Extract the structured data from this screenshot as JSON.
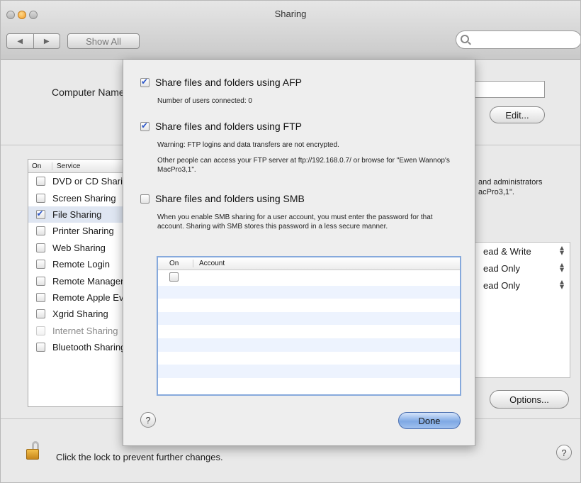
{
  "window": {
    "title": "Sharing"
  },
  "toolbar": {
    "show_all_label": "Show All",
    "back_glyph": "◀",
    "forward_glyph": "▶",
    "search_placeholder": ""
  },
  "computer_name": {
    "label": "Computer Name:",
    "value": "",
    "edit_label": "Edit..."
  },
  "services": {
    "header_on": "On",
    "header_service": "Service",
    "items": [
      {
        "label": "DVD or CD Sharing",
        "on": false,
        "selected": false
      },
      {
        "label": "Screen Sharing",
        "on": false,
        "selected": false
      },
      {
        "label": "File Sharing",
        "on": true,
        "selected": true
      },
      {
        "label": "Printer Sharing",
        "on": false,
        "selected": false
      },
      {
        "label": "Web Sharing",
        "on": false,
        "selected": false
      },
      {
        "label": "Remote Login",
        "on": false,
        "selected": false
      },
      {
        "label": "Remote Management",
        "on": false,
        "selected": false
      },
      {
        "label": "Remote Apple Events",
        "on": false,
        "selected": false
      },
      {
        "label": "Xgrid Sharing",
        "on": false,
        "selected": false
      },
      {
        "label": "Internet Sharing",
        "on": false,
        "selected": false,
        "dimmed": true
      },
      {
        "label": "Bluetooth Sharing",
        "on": false,
        "selected": false
      }
    ]
  },
  "file_sharing": {
    "description_tail": "and administrators",
    "description_tail2": "acPro3,1\".",
    "permissions": [
      "ead & Write",
      "ead Only",
      "ead Only"
    ],
    "options_label": "Options..."
  },
  "lock": {
    "text": "Click the lock to prevent further changes."
  },
  "help": {
    "glyph": "?"
  },
  "sheet": {
    "afp": {
      "label": "Share files and folders using AFP",
      "checked": true,
      "note": "Number of users connected: 0"
    },
    "ftp": {
      "label": "Share files and folders using FTP",
      "checked": true,
      "warning": "Warning: FTP logins and data transfers are not encrypted.",
      "access": "Other people can access your FTP server at ftp://192.168.0.7/ or browse for \"Ewen Wannop's MacPro3,1\"."
    },
    "smb": {
      "label": "Share files and folders using SMB",
      "checked": false,
      "note": "When you enable SMB sharing for a user account, you must enter the password for that account. Sharing with SMB stores this password in a less secure manner."
    },
    "accounts": {
      "header_on": "On",
      "header_account": "Account",
      "rows": [
        {
          "on": false
        }
      ]
    },
    "done_label": "Done"
  }
}
